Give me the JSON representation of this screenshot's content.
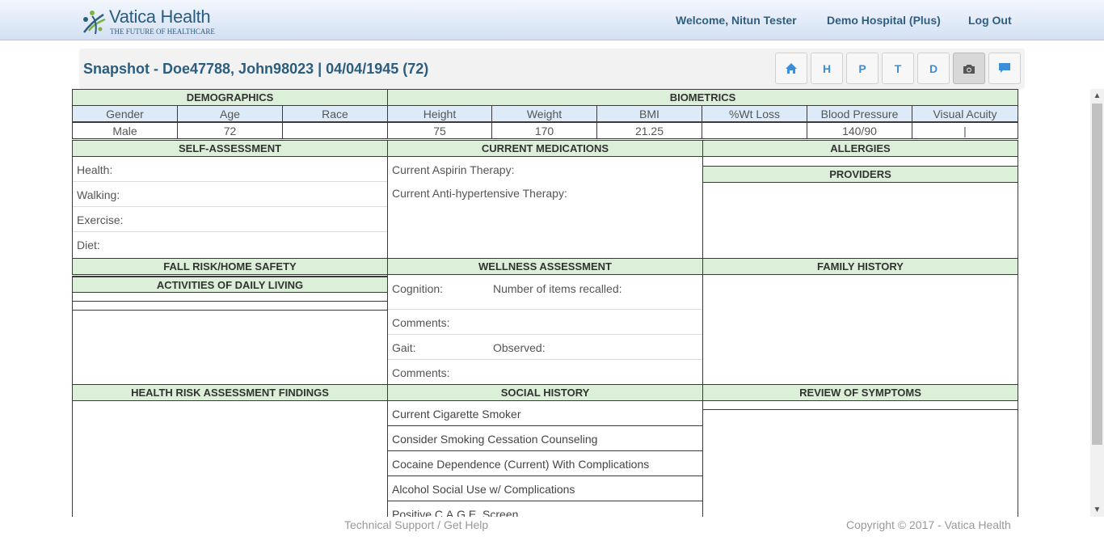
{
  "header": {
    "logo_name": "Vatica Health",
    "logo_tagline": "THE FUTURE OF HEALTHCARE",
    "welcome": "Welcome, Nitun Tester",
    "hospital": "Demo Hospital (Plus)",
    "logout": "Log Out"
  },
  "snapshot": {
    "title": "Snapshot - Doe47788, John98023 | 04/04/1945 (72)",
    "buttons": {
      "h": "H",
      "p": "P",
      "t": "T",
      "d": "D"
    }
  },
  "demographics": {
    "title": "DEMOGRAPHICS",
    "columns": [
      "Gender",
      "Age",
      "Race"
    ],
    "values": [
      "Male",
      "72",
      ""
    ]
  },
  "biometrics": {
    "title": "BIOMETRICS",
    "columns": [
      "Height",
      "Weight",
      "BMI",
      "%Wt Loss",
      "Blood Pressure",
      "Visual Acuity"
    ],
    "values": [
      "75",
      "170",
      "21.25",
      "",
      "140/90",
      "|"
    ]
  },
  "self_assessment": {
    "title": "SELF-ASSESSMENT",
    "items": [
      "Health:",
      "Walking:",
      "Exercise:",
      "Diet:"
    ]
  },
  "current_medications": {
    "title": "CURRENT MEDICATIONS",
    "items": [
      "Current Aspirin Therapy:",
      "Current Anti-hypertensive Therapy:"
    ]
  },
  "allergies": {
    "title": "ALLERGIES"
  },
  "providers": {
    "title": "PROVIDERS"
  },
  "fall_risk": {
    "title": "FALL RISK/HOME SAFETY"
  },
  "adl": {
    "title": "ACTIVITIES OF DAILY LIVING"
  },
  "wellness": {
    "title": "WELLNESS ASSESSMENT",
    "cognition": "Cognition:",
    "items_recalled": "Number of items recalled:",
    "comments1": "Comments:",
    "gait": "Gait:",
    "observed": "Observed:",
    "comments2": "Comments:"
  },
  "family_history": {
    "title": "FAMILY HISTORY"
  },
  "hra_findings": {
    "title": "HEALTH RISK ASSESSMENT FINDINGS"
  },
  "social_history": {
    "title": "SOCIAL HISTORY",
    "items": [
      "Current Cigarette Smoker",
      "Consider Smoking Cessation Counseling",
      "Cocaine Dependence (Current) With Complications",
      "Alcohol Social Use w/ Complications",
      "Positive C.A.G.E. Screen"
    ]
  },
  "review_of_symptoms": {
    "title": "REVIEW OF SYMPTOMS"
  },
  "footer": {
    "support": "Technical Support / Get Help",
    "copyright": "Copyright © 2017 - Vatica Health"
  }
}
